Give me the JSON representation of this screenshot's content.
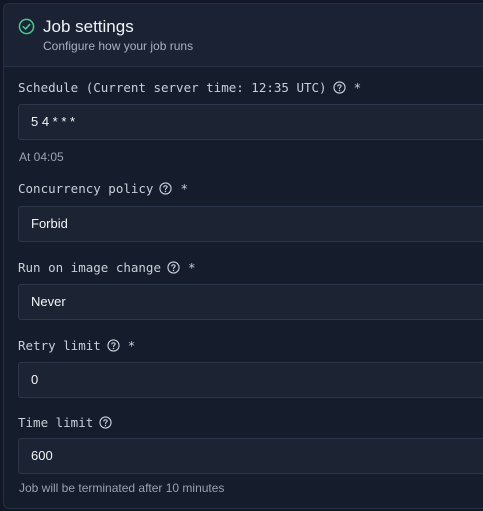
{
  "header": {
    "title": "Job settings",
    "subtitle": "Configure how your job runs"
  },
  "fields": {
    "schedule": {
      "label": "Schedule (Current server time: 12:35 UTC)",
      "required": "*",
      "value": "5 4 * * *",
      "hint": "At 04:05"
    },
    "concurrency": {
      "label": "Concurrency policy",
      "required": "*",
      "value": "Forbid"
    },
    "image_change": {
      "label": "Run on image change",
      "required": "*",
      "value": "Never"
    },
    "retry": {
      "label": "Retry limit",
      "required": "*",
      "value": "0"
    },
    "time_limit": {
      "label": "Time limit",
      "value": "600",
      "hint": "Job will be terminated after 10 minutes"
    }
  },
  "colors": {
    "accent_check": "#3fcf8e",
    "background": "#151c2b"
  },
  "icons": {
    "header": "check-circle-icon",
    "help": "question-circle-icon"
  }
}
